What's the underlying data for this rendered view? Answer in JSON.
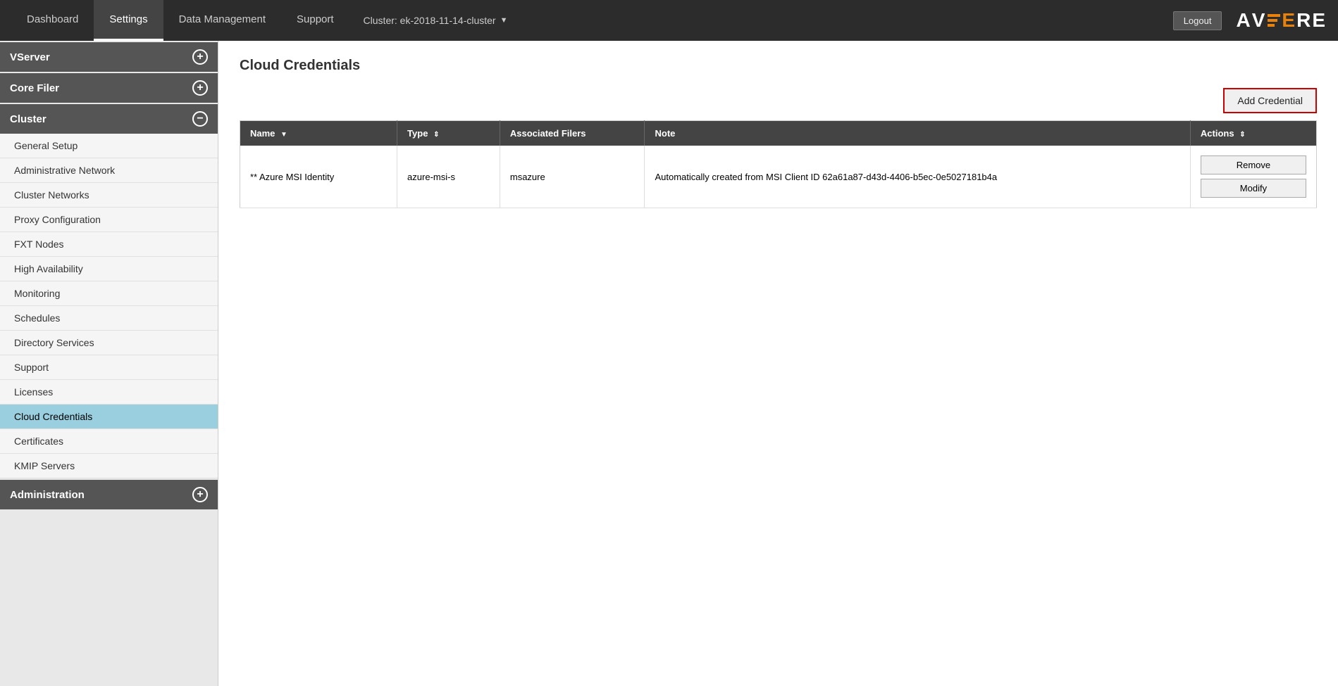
{
  "topbar": {
    "tabs": [
      {
        "id": "dashboard",
        "label": "Dashboard",
        "active": false
      },
      {
        "id": "settings",
        "label": "Settings",
        "active": true
      },
      {
        "id": "data-management",
        "label": "Data Management",
        "active": false
      },
      {
        "id": "support",
        "label": "Support",
        "active": false
      }
    ],
    "cluster_label": "Cluster: ek-2018-11-14-cluster",
    "logout_label": "Logout",
    "logo_text_a": "A",
    "logo_text_v": "V",
    "logo_text_e1": "E",
    "logo_text_r": "R",
    "logo_text_e2": "E"
  },
  "sidebar": {
    "sections": [
      {
        "id": "vserver",
        "label": "VServer",
        "icon": "+",
        "items": []
      },
      {
        "id": "core-filer",
        "label": "Core Filer",
        "icon": "+",
        "items": []
      },
      {
        "id": "cluster",
        "label": "Cluster",
        "icon": "−",
        "items": [
          {
            "id": "general-setup",
            "label": "General Setup",
            "active": false
          },
          {
            "id": "administrative-network",
            "label": "Administrative Network",
            "active": false
          },
          {
            "id": "cluster-networks",
            "label": "Cluster Networks",
            "active": false
          },
          {
            "id": "proxy-configuration",
            "label": "Proxy Configuration",
            "active": false
          },
          {
            "id": "fxt-nodes",
            "label": "FXT Nodes",
            "active": false
          },
          {
            "id": "high-availability",
            "label": "High Availability",
            "active": false
          },
          {
            "id": "monitoring",
            "label": "Monitoring",
            "active": false
          },
          {
            "id": "schedules",
            "label": "Schedules",
            "active": false
          },
          {
            "id": "directory-services",
            "label": "Directory Services",
            "active": false
          },
          {
            "id": "support",
            "label": "Support",
            "active": false
          },
          {
            "id": "licenses",
            "label": "Licenses",
            "active": false
          },
          {
            "id": "cloud-credentials",
            "label": "Cloud Credentials",
            "active": true
          },
          {
            "id": "certificates",
            "label": "Certificates",
            "active": false
          },
          {
            "id": "kmip-servers",
            "label": "KMIP Servers",
            "active": false
          }
        ]
      },
      {
        "id": "administration",
        "label": "Administration",
        "icon": "+",
        "items": []
      }
    ]
  },
  "main": {
    "page_title": "Cloud Credentials",
    "add_credential_label": "Add Credential",
    "table": {
      "columns": [
        {
          "id": "name",
          "label": "Name",
          "sortable": true
        },
        {
          "id": "type",
          "label": "Type",
          "sortable": true
        },
        {
          "id": "associated-filers",
          "label": "Associated Filers",
          "sortable": false
        },
        {
          "id": "note",
          "label": "Note",
          "sortable": false
        },
        {
          "id": "actions",
          "label": "Actions",
          "sortable": true
        }
      ],
      "rows": [
        {
          "name": "** Azure MSI Identity",
          "type": "azure-msi-s",
          "associated_filers": "msazure",
          "note": "Automatically created from MSI Client ID 62a61a87-d43d-4406-b5ec-0e5027181b4a",
          "actions": [
            "Remove",
            "Modify"
          ]
        }
      ]
    }
  }
}
